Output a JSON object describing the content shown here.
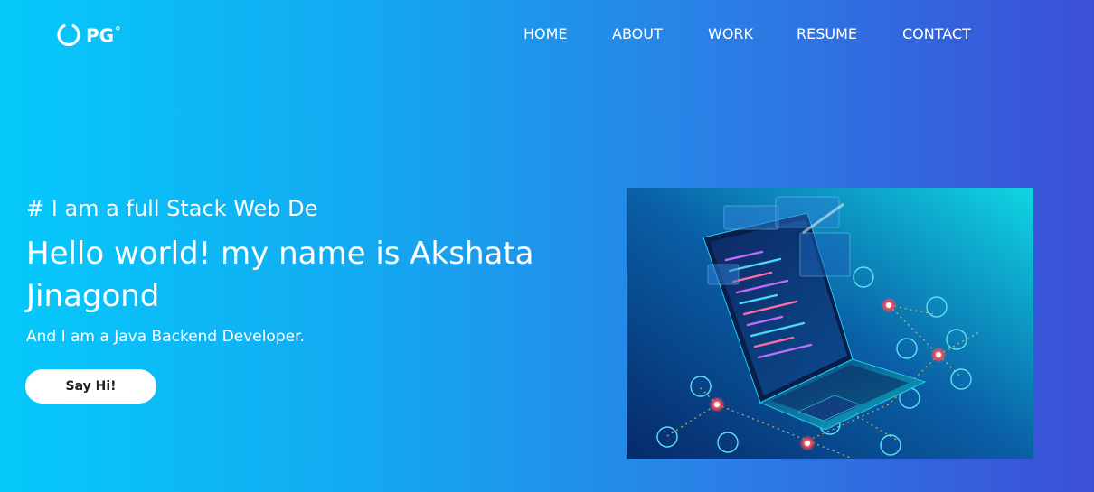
{
  "brand": {
    "logo_text": "PG",
    "logo_suffix": "°"
  },
  "nav": {
    "items": [
      {
        "label": "HOME"
      },
      {
        "label": "ABOUT"
      },
      {
        "label": "WORK"
      },
      {
        "label": "RESUME"
      },
      {
        "label": "CONTACT"
      }
    ]
  },
  "hero": {
    "tagline": "# I am a full Stack Web De",
    "title": "Hello world! my name is Akshata Jinagond",
    "subtitle": "And I am a Java Backend Developer.",
    "cta_label": "Say Hi!"
  },
  "colors": {
    "gradient_start": "#05c9fb",
    "gradient_end": "#3b4fd6",
    "button_bg": "#ffffff",
    "button_text": "#222222"
  },
  "icons": {
    "logo": "ring-logo-icon",
    "illustration": "laptop-circuit-illustration"
  }
}
